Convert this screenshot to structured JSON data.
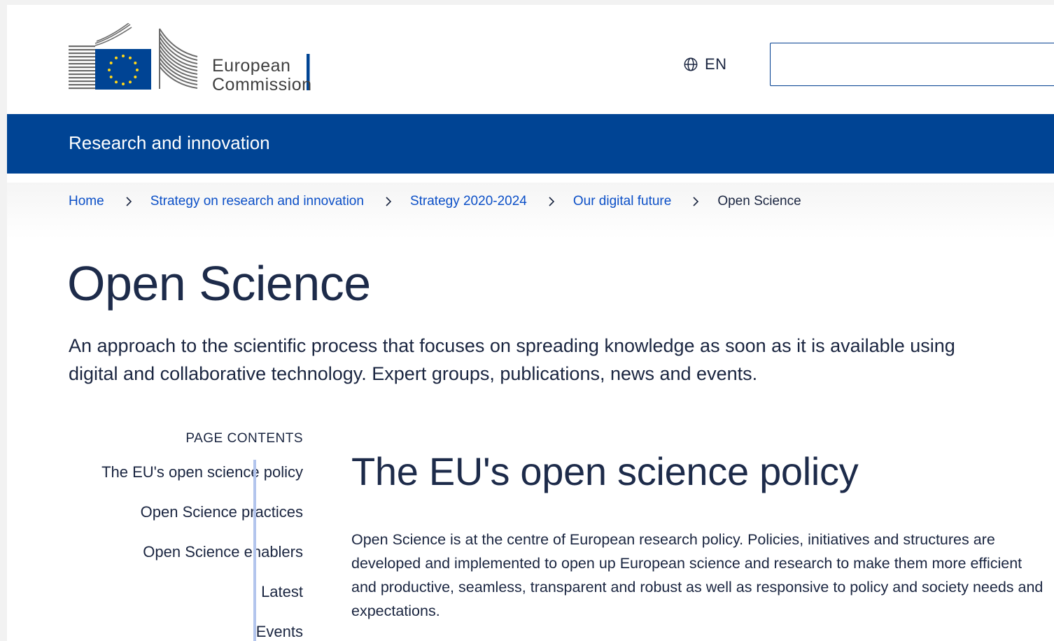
{
  "header": {
    "logo_text_line1": "European",
    "logo_text_line2": "Commission",
    "language_code": "EN",
    "search_value": ""
  },
  "site": {
    "name": "Research and innovation"
  },
  "breadcrumb": {
    "items": [
      "Home",
      "Strategy on research and innovation",
      "Strategy 2020-2024",
      "Our digital future"
    ],
    "current": "Open Science"
  },
  "page": {
    "title": "Open Science",
    "intro": "An approach to the scientific process that focuses on spreading knowledge as soon as it is available using digital and collaborative technology. Expert groups, publications, news and events."
  },
  "toc": {
    "heading": "PAGE CONTENTS",
    "items": [
      "The EU's open science policy",
      "Open Science practices",
      "Open Science enablers",
      "Latest",
      "Events"
    ]
  },
  "section": {
    "title": "The EU's open science policy",
    "body": "Open Science is at the centre of European research policy. Policies, initiatives and structures are developed and implemented to open up European science and research to make them more efficient and productive, seamless, transparent and robust as well as responsive to policy and society needs and expectations."
  },
  "colors": {
    "brand_blue": "#004494",
    "link_blue": "#0b4fc7",
    "eu_yellow": "#ffd617",
    "toc_rule": "#b3c5ed"
  }
}
